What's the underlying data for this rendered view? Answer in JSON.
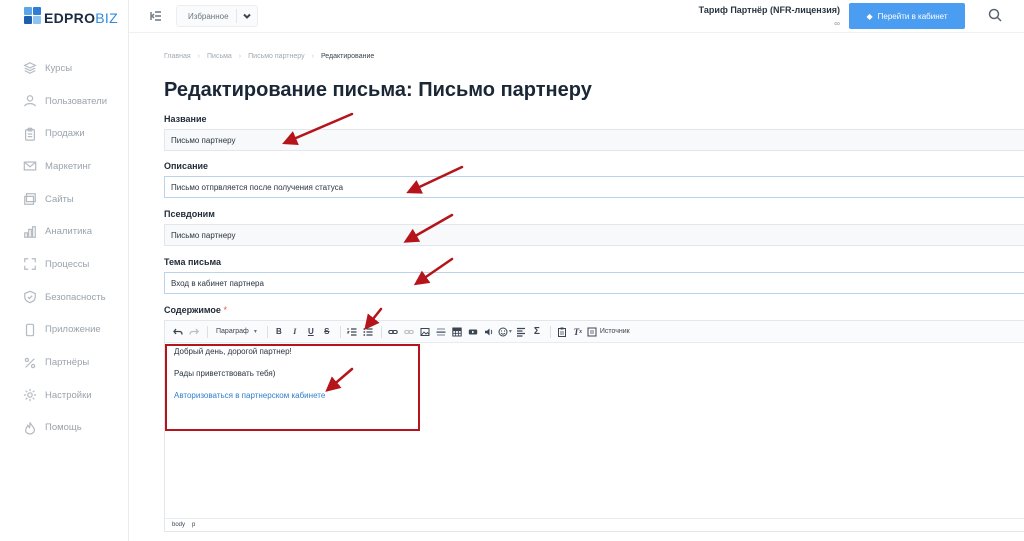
{
  "brand": {
    "name_main": "EDPRO",
    "name_accent": "BIZ"
  },
  "sidebar": {
    "items": [
      {
        "label": "Курсы",
        "icon": "layers-icon"
      },
      {
        "label": "Пользователи",
        "icon": "user-icon"
      },
      {
        "label": "Продажи",
        "icon": "clipboard-icon"
      },
      {
        "label": "Маркетинг",
        "icon": "mail-icon"
      },
      {
        "label": "Сайты",
        "icon": "browser-windows-icon"
      },
      {
        "label": "Аналитика",
        "icon": "bar-chart-icon"
      },
      {
        "label": "Процессы",
        "icon": "expand-icon"
      },
      {
        "label": "Безопасность",
        "icon": "shield-icon"
      },
      {
        "label": "Приложение",
        "icon": "smartphone-icon"
      },
      {
        "label": "Партнёры",
        "icon": "percent-icon"
      },
      {
        "label": "Настройки",
        "icon": "gear-icon"
      },
      {
        "label": "Помощь",
        "icon": "flame-icon"
      }
    ]
  },
  "topbar": {
    "favorites_label": "Избранное",
    "tariff_name": "Тариф Партнёр (NFR-лицензия)",
    "tariff_term": "∞",
    "cabinet_button": "Перейти в кабинет"
  },
  "breadcrumb": {
    "items": [
      "Главная",
      "Письма",
      "Письмо партнеру"
    ],
    "current": "Редактирование"
  },
  "page": {
    "title": "Редактирование письма: Письмо партнеру"
  },
  "form": {
    "name": {
      "label": "Название",
      "value": "Письмо партнеру"
    },
    "description": {
      "label": "Описание",
      "value": "Письмо отпрвляется после получения статуса"
    },
    "alias": {
      "label": "Псевдоним",
      "value": "Письмо партнеру"
    },
    "subject": {
      "label": "Тема письма",
      "value": "Вход в кабинет партнера"
    },
    "content": {
      "label": "Содержимое",
      "required_mark": "*"
    }
  },
  "editor": {
    "paragraph_format": "Параграф",
    "source_label": "Источник",
    "body": {
      "line1": "Добрый день, дорогой партнер!",
      "line2": "Рады приветствовать тебя)",
      "link": "Авторизоваться в партнерском кабинете"
    },
    "status_path": [
      "body",
      "p"
    ]
  },
  "colors": {
    "accent": "#4a9df0",
    "link": "#2f7fcb",
    "annotation": "#b4141a"
  }
}
